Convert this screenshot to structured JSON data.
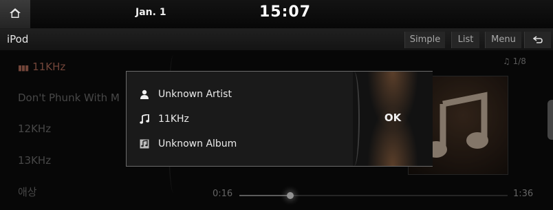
{
  "header": {
    "date": "Jan. 1",
    "time": "15:07"
  },
  "source": {
    "title": "iPod"
  },
  "modes": {
    "simple": "Simple",
    "list": "List",
    "menu": "Menu"
  },
  "playlist": {
    "tracks": [
      "11KHz",
      "Don't Phunk With M",
      "12KHz",
      "13KHz",
      "애상"
    ],
    "current_index": 0,
    "counter": "1/8"
  },
  "playback": {
    "elapsed": "0:16",
    "total": "1:36",
    "progress": 0.19
  },
  "popup": {
    "artist": "Unknown Artist",
    "title": "11KHz",
    "album": "Unknown Album",
    "ok_label": "OK"
  },
  "colors": {
    "accent": "#b06a58",
    "background": "#0b0b0b"
  },
  "icons": {
    "home": "home-icon",
    "back": "back-arrow-icon",
    "artist": "person-icon",
    "title": "music-note-icon",
    "album": "album-icon"
  }
}
